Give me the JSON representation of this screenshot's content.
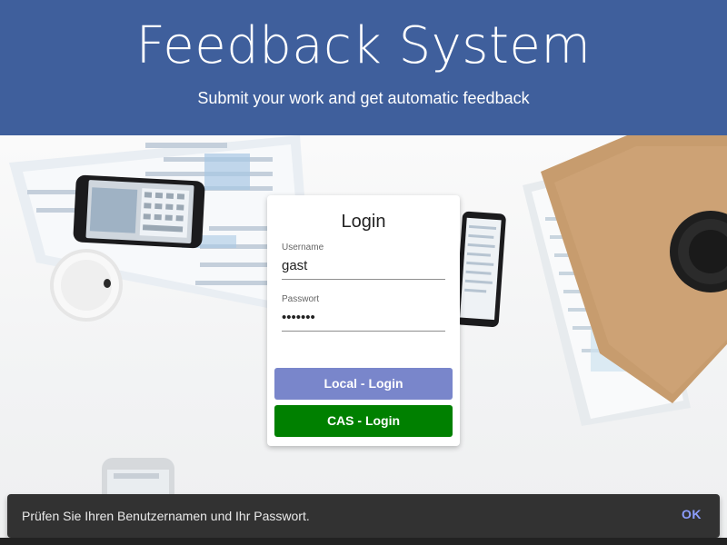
{
  "header": {
    "title": "Feedback System",
    "subtitle": "Submit your work and get automatic feedback"
  },
  "login": {
    "title": "Login",
    "username_label": "Username",
    "username_value": "gast",
    "password_label": "Passwort",
    "password_value": "•••••••",
    "local_button": "Local - Login",
    "cas_button": "CAS - Login"
  },
  "snackbar": {
    "message": "Prüfen Sie Ihren Benutzernamen und Ihr Passwort.",
    "action": "OK"
  },
  "colors": {
    "header_bg": "#3f5f9c",
    "local_button": "#7986cb",
    "cas_button": "#008000",
    "snackbar_bg": "#323232",
    "snackbar_action": "#8c9eff"
  }
}
